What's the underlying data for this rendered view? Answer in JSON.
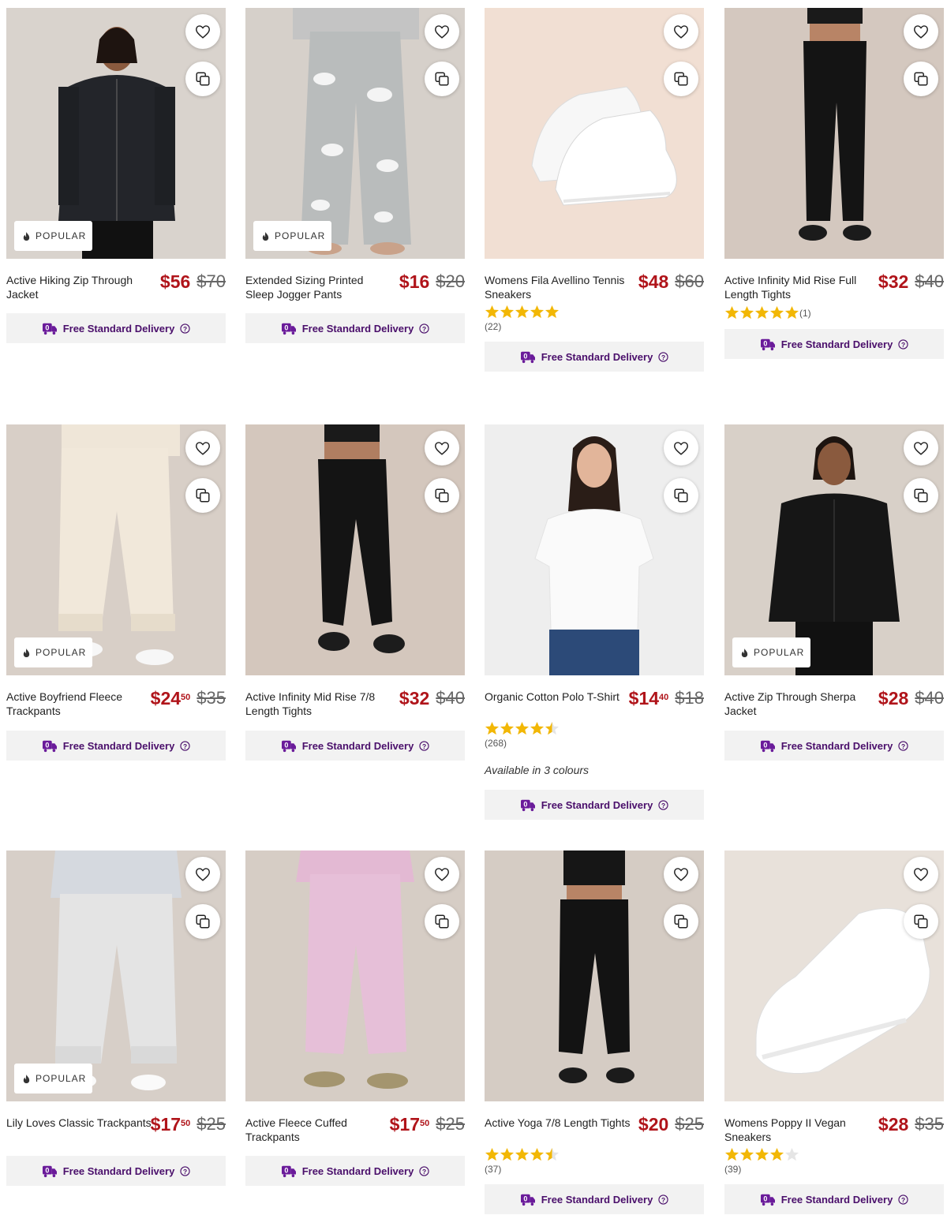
{
  "colors": {
    "price": "#b0141a",
    "delivery_text": "#4a0f6b",
    "delivery_bg": "#f2f2f2",
    "star": "#f2b705"
  },
  "badge_popular": "POPULAR",
  "delivery_label": "Free Standard Delivery",
  "icons": {
    "wishlist": "heart-icon",
    "quickview": "copy-icon",
    "popular": "flame-icon",
    "delivery": "delivery-van-icon",
    "info": "question-circle-icon"
  },
  "products": [
    {
      "title": "Active Hiking Zip Through Jacket",
      "price_dollars": "$56",
      "price_cents": "",
      "was": "$70",
      "popular": true
    },
    {
      "title": "Extended Sizing Printed Sleep Jogger Pants",
      "price_dollars": "$16",
      "price_cents": "",
      "was": "$20",
      "popular": true
    },
    {
      "title": "Womens Fila Avellino Tennis Sneakers",
      "price_dollars": "$48",
      "price_cents": "",
      "was": "$60",
      "popular": false,
      "rating": 5,
      "reviews": "(22)"
    },
    {
      "title": "Active Infinity Mid Rise Full Length Tights",
      "price_dollars": "$32",
      "price_cents": "",
      "was": "$40",
      "popular": false,
      "rating": 5,
      "reviews": "(1)"
    },
    {
      "title": "Active Boyfriend Fleece Trackpants",
      "price_dollars": "$24",
      "price_cents": "50",
      "was": "$35",
      "popular": true
    },
    {
      "title": "Active Infinity Mid Rise 7/8 Length Tights",
      "price_dollars": "$32",
      "price_cents": "",
      "was": "$40",
      "popular": false
    },
    {
      "title": "Organic Cotton Polo T-Shirt",
      "price_dollars": "$14",
      "price_cents": "40",
      "was": "$18",
      "popular": false,
      "rating": 4.5,
      "reviews": "(268)",
      "availability": "Available in 3 colours"
    },
    {
      "title": "Active Zip Through Sherpa Jacket",
      "price_dollars": "$28",
      "price_cents": "",
      "was": "$40",
      "popular": true
    },
    {
      "title": "Lily Loves Classic Trackpants",
      "price_dollars": "$17",
      "price_cents": "50",
      "was": "$25",
      "popular": true
    },
    {
      "title": "Active Fleece Cuffed Trackpants",
      "price_dollars": "$17",
      "price_cents": "50",
      "was": "$25",
      "popular": false
    },
    {
      "title": "Active Yoga 7/8 Length Tights",
      "price_dollars": "$20",
      "price_cents": "",
      "was": "$25",
      "popular": false,
      "rating": 4.5,
      "reviews": "(37)"
    },
    {
      "title": "Womens Poppy II Vegan Sneakers",
      "price_dollars": "$28",
      "price_cents": "",
      "was": "$35",
      "popular": false,
      "rating": 4,
      "reviews": "(39)"
    }
  ]
}
